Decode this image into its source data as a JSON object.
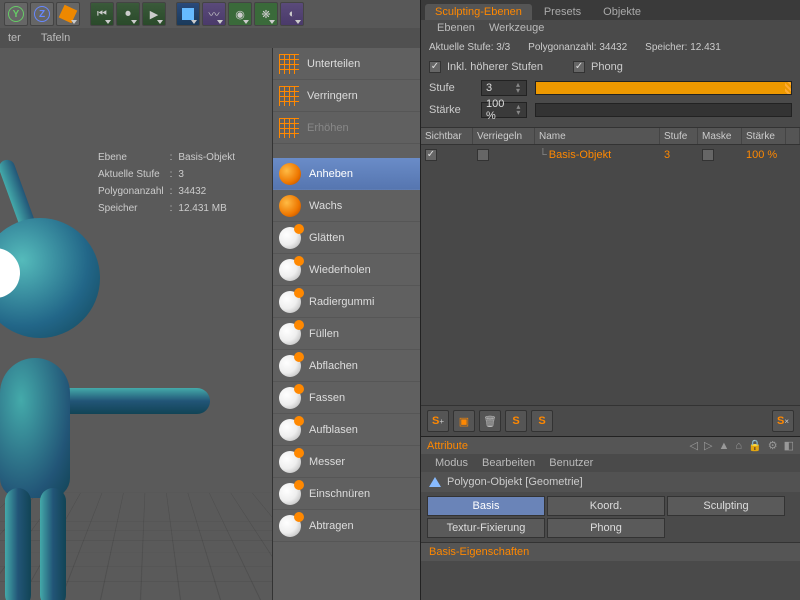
{
  "toolbar": {
    "sub_items": [
      "ter",
      "Tafeln"
    ]
  },
  "viewport_info": {
    "rows": [
      [
        "Ebene",
        ":",
        "Basis-Objekt"
      ],
      [
        "Aktuelle Stufe",
        ":",
        "3"
      ],
      [
        "Polygonanzahl",
        ":",
        "34432"
      ],
      [
        "Speicher",
        ":",
        "12.431 MB"
      ]
    ]
  },
  "palette": [
    {
      "label": "Unterteilen",
      "icon": "pi-grid"
    },
    {
      "label": "Verringern",
      "icon": "pi-grid"
    },
    {
      "label": "Erhöhen",
      "icon": "pi-grid",
      "disabled": true
    },
    {
      "label": "Anheben",
      "icon": "pi-orange",
      "selected": true
    },
    {
      "label": "Wachs",
      "icon": "pi-orange"
    },
    {
      "label": "Glätten",
      "icon": "pi-sphere"
    },
    {
      "label": "Wiederholen",
      "icon": "pi-sphere"
    },
    {
      "label": "Radiergummi",
      "icon": "pi-sphere"
    },
    {
      "label": "Füllen",
      "icon": "pi-sphere"
    },
    {
      "label": "Abflachen",
      "icon": "pi-sphere"
    },
    {
      "label": "Fassen",
      "icon": "pi-sphere"
    },
    {
      "label": "Aufblasen",
      "icon": "pi-sphere"
    },
    {
      "label": "Messer",
      "icon": "pi-sphere"
    },
    {
      "label": "Einschnüren",
      "icon": "pi-sphere"
    },
    {
      "label": "Abtragen",
      "icon": "pi-sphere"
    }
  ],
  "right": {
    "tabs": [
      "Sculpting-Ebenen",
      "Presets",
      "Objekte"
    ],
    "subtabs": [
      "Ebenen",
      "Werkzeuge"
    ],
    "status": {
      "level_label": "Aktuelle Stufe:",
      "level_value": "3/3",
      "poly_label": "Polygonanzahl:",
      "poly_value": "34432",
      "mem_label": "Speicher:",
      "mem_value": "12.431"
    },
    "checks": {
      "incl": "Inkl. höherer Stufen",
      "phong": "Phong"
    },
    "stufe_label": "Stufe",
    "stufe_value": "3",
    "staerke_label": "Stärke",
    "staerke_value": "100 %",
    "columns": [
      "Sichtbar",
      "Verriegeln",
      "Name",
      "Stufe",
      "Maske",
      "Stärke"
    ],
    "row": {
      "name": "Basis-Objekt",
      "level": "3",
      "strength": "100 %"
    },
    "attribute": {
      "title": "Attribute",
      "menu": [
        "Modus",
        "Bearbeiten",
        "Benutzer"
      ],
      "object": "Polygon-Objekt [Geometrie]",
      "tabs": [
        "Basis",
        "Koord.",
        "Sculpting",
        "Textur-Fixierung",
        "Phong"
      ],
      "section": "Basis-Eigenschaften"
    }
  }
}
